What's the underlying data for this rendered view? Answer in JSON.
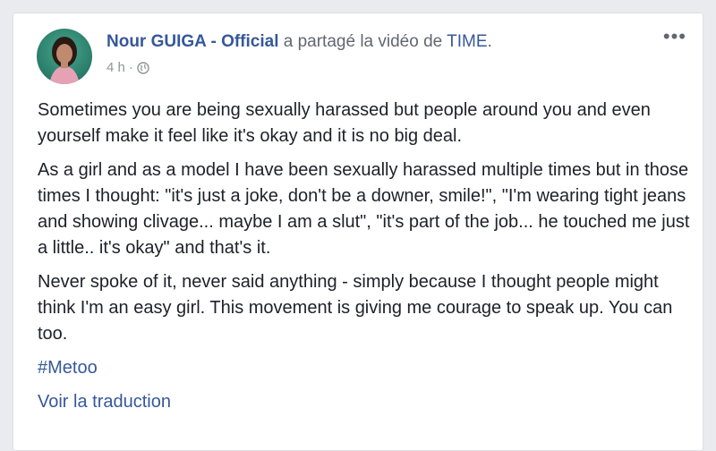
{
  "post": {
    "author": "Nour GUIGA - Official",
    "shared_text": "a partagé la vidéo de",
    "shared_source": "TIME",
    "shared_suffix": ".",
    "time": "4 h",
    "separator": "·",
    "privacy_icon": "globe-icon",
    "more_label": "•••",
    "paragraphs": [
      "Sometimes you are being sexually harassed but people around you and even yourself make it feel like it's okay and it is no big deal.",
      "As a girl and as a model I have been sexually harassed multiple times but in those times I thought: \"it's just a joke, don't be a downer, smile!\", \"I'm wearing tight jeans and showing clivage... maybe I am a slut\", \"it's part of the job... he touched me just a little.. it's okay\" and that's it.",
      "Never spoke of it, never said anything - simply because I thought people might think I'm an easy girl. This movement is giving me courage to speak up. You can too."
    ],
    "hashtag": "#Metoo",
    "translate_label": "Voir la traduction"
  },
  "colors": {
    "link": "#365899",
    "text": "#1d2129",
    "meta": "#90949c",
    "background": "#e9ebee"
  }
}
